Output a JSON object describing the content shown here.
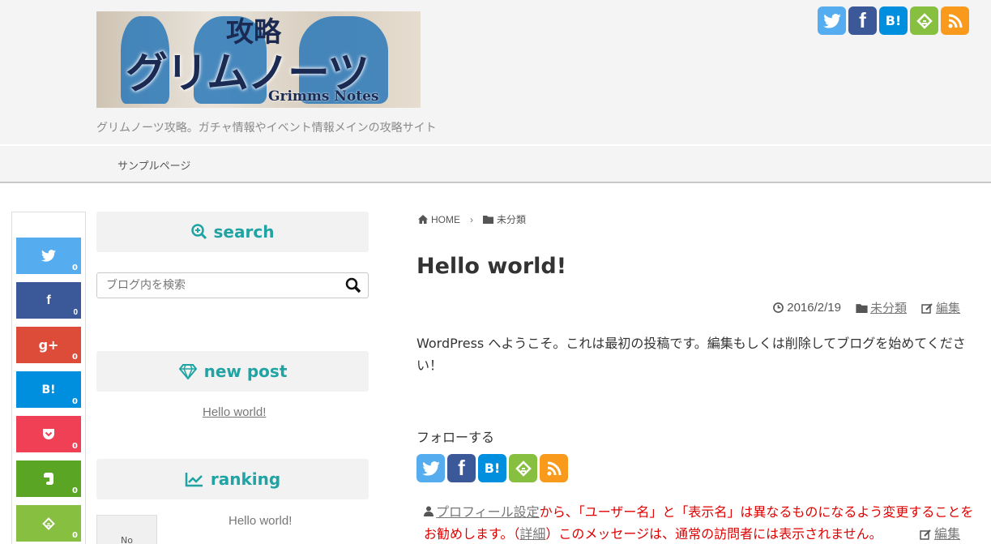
{
  "header": {
    "logo": {
      "kanji": "攻略",
      "kana": "グリムノーツ",
      "en": "Grimms Notes"
    },
    "tagline": "グリムノーツ攻略。ガチャ情報やイベント情報メインの攻略サイト",
    "social_icons": [
      {
        "name": "twitter-icon",
        "glyph": "🐦",
        "color": "#55acee"
      },
      {
        "name": "facebook-icon",
        "glyph": "f",
        "color": "#3b5998"
      },
      {
        "name": "hatena-icon",
        "glyph": "B!",
        "color": "#008fde"
      },
      {
        "name": "feedly-icon",
        "glyph": "⚐",
        "color": "#87c040"
      },
      {
        "name": "rss-icon",
        "glyph": "◉",
        "color": "#f99a1c"
      }
    ]
  },
  "nav": {
    "items": [
      {
        "label": "サンプルページ"
      }
    ]
  },
  "share": {
    "buttons": [
      {
        "name": "share-twitter-button",
        "glyph": "🐦",
        "count": "0"
      },
      {
        "name": "share-facebook-button",
        "glyph": "f",
        "count": "0"
      },
      {
        "name": "share-googleplus-button",
        "glyph": "g+",
        "count": "0"
      },
      {
        "name": "share-hatena-button",
        "glyph": "B!",
        "count": "0"
      },
      {
        "name": "share-pocket-button",
        "glyph": "⌄",
        "count": "0"
      },
      {
        "name": "share-evernote-button",
        "glyph": "✎",
        "count": "0"
      },
      {
        "name": "share-feedly-button",
        "glyph": "⚐",
        "count": "0"
      }
    ]
  },
  "sidebar": {
    "search": {
      "title": "search",
      "placeholder": "ブログ内を検索"
    },
    "new_post": {
      "title": "new post",
      "items": [
        "Hello world!"
      ]
    },
    "ranking": {
      "title": "ranking",
      "items": [
        {
          "title": "Hello world!",
          "thumb": "No"
        }
      ]
    }
  },
  "main": {
    "breadcrumb": {
      "home": "HOME",
      "sep": "›",
      "category": "未分類"
    },
    "title": "Hello world!",
    "meta": {
      "date": "2016/2/19",
      "category": "未分類",
      "edit": "編集"
    },
    "body": "WordPress へようこそ。これは最初の投稿です。編集もしくは削除してブログを始めてください！",
    "follow_label": "フォローする",
    "notice": {
      "profile_link": "プロフィール設定",
      "text1": "から、「ユーザー名」と「表示名」は異なるものになるよう変更することをお勧めします。（",
      "detail_link": "詳細",
      "text2": "）このメッセージは、通常の訪問者には表示されません。",
      "edit": "編集"
    }
  }
}
